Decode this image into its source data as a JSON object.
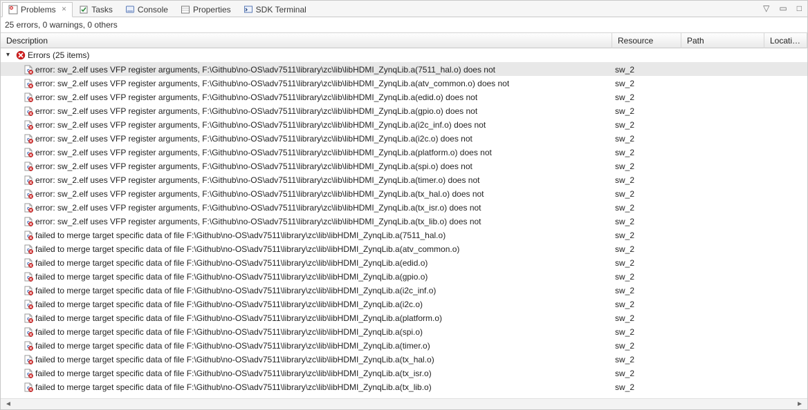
{
  "tabs": [
    {
      "label": "Problems",
      "active": true,
      "closable": true
    },
    {
      "label": "Tasks",
      "active": false
    },
    {
      "label": "Console",
      "active": false
    },
    {
      "label": "Properties",
      "active": false
    },
    {
      "label": "SDK Terminal",
      "active": false
    }
  ],
  "toolbar": {
    "menu_glyph": "▽",
    "minimize_glyph": "▭",
    "maximize_glyph": "□"
  },
  "summary": "25 errors, 0 warnings, 0 others",
  "columns": {
    "description": "Description",
    "resource": "Resource",
    "path": "Path",
    "location": "Location"
  },
  "group": {
    "label": "Errors (25 items)",
    "expanded": true
  },
  "items": [
    {
      "text": "error: sw_2.elf uses VFP register arguments, F:\\Github\\no-OS\\adv7511\\library\\zc\\lib\\libHDMI_ZynqLib.a(7511_hal.o) does not",
      "resource": "sw_2",
      "selected": true
    },
    {
      "text": "error: sw_2.elf uses VFP register arguments, F:\\Github\\no-OS\\adv7511\\library\\zc\\lib\\libHDMI_ZynqLib.a(atv_common.o) does not",
      "resource": "sw_2"
    },
    {
      "text": "error: sw_2.elf uses VFP register arguments, F:\\Github\\no-OS\\adv7511\\library\\zc\\lib\\libHDMI_ZynqLib.a(edid.o) does not",
      "resource": "sw_2"
    },
    {
      "text": "error: sw_2.elf uses VFP register arguments, F:\\Github\\no-OS\\adv7511\\library\\zc\\lib\\libHDMI_ZynqLib.a(gpio.o) does not",
      "resource": "sw_2"
    },
    {
      "text": "error: sw_2.elf uses VFP register arguments, F:\\Github\\no-OS\\adv7511\\library\\zc\\lib\\libHDMI_ZynqLib.a(i2c_inf.o) does not",
      "resource": "sw_2"
    },
    {
      "text": "error: sw_2.elf uses VFP register arguments, F:\\Github\\no-OS\\adv7511\\library\\zc\\lib\\libHDMI_ZynqLib.a(i2c.o) does not",
      "resource": "sw_2"
    },
    {
      "text": "error: sw_2.elf uses VFP register arguments, F:\\Github\\no-OS\\adv7511\\library\\zc\\lib\\libHDMI_ZynqLib.a(platform.o) does not",
      "resource": "sw_2"
    },
    {
      "text": "error: sw_2.elf uses VFP register arguments, F:\\Github\\no-OS\\adv7511\\library\\zc\\lib\\libHDMI_ZynqLib.a(spi.o) does not",
      "resource": "sw_2"
    },
    {
      "text": "error: sw_2.elf uses VFP register arguments, F:\\Github\\no-OS\\adv7511\\library\\zc\\lib\\libHDMI_ZynqLib.a(timer.o) does not",
      "resource": "sw_2"
    },
    {
      "text": "error: sw_2.elf uses VFP register arguments, F:\\Github\\no-OS\\adv7511\\library\\zc\\lib\\libHDMI_ZynqLib.a(tx_hal.o) does not",
      "resource": "sw_2"
    },
    {
      "text": "error: sw_2.elf uses VFP register arguments, F:\\Github\\no-OS\\adv7511\\library\\zc\\lib\\libHDMI_ZynqLib.a(tx_isr.o) does not",
      "resource": "sw_2"
    },
    {
      "text": "error: sw_2.elf uses VFP register arguments, F:\\Github\\no-OS\\adv7511\\library\\zc\\lib\\libHDMI_ZynqLib.a(tx_lib.o) does not",
      "resource": "sw_2"
    },
    {
      "text": "failed to merge target specific data of file F:\\Github\\no-OS\\adv7511\\library\\zc\\lib\\libHDMI_ZynqLib.a(7511_hal.o)",
      "resource": "sw_2"
    },
    {
      "text": "failed to merge target specific data of file F:\\Github\\no-OS\\adv7511\\library\\zc\\lib\\libHDMI_ZynqLib.a(atv_common.o)",
      "resource": "sw_2"
    },
    {
      "text": "failed to merge target specific data of file F:\\Github\\no-OS\\adv7511\\library\\zc\\lib\\libHDMI_ZynqLib.a(edid.o)",
      "resource": "sw_2"
    },
    {
      "text": "failed to merge target specific data of file F:\\Github\\no-OS\\adv7511\\library\\zc\\lib\\libHDMI_ZynqLib.a(gpio.o)",
      "resource": "sw_2"
    },
    {
      "text": "failed to merge target specific data of file F:\\Github\\no-OS\\adv7511\\library\\zc\\lib\\libHDMI_ZynqLib.a(i2c_inf.o)",
      "resource": "sw_2"
    },
    {
      "text": "failed to merge target specific data of file F:\\Github\\no-OS\\adv7511\\library\\zc\\lib\\libHDMI_ZynqLib.a(i2c.o)",
      "resource": "sw_2"
    },
    {
      "text": "failed to merge target specific data of file F:\\Github\\no-OS\\adv7511\\library\\zc\\lib\\libHDMI_ZynqLib.a(platform.o)",
      "resource": "sw_2"
    },
    {
      "text": "failed to merge target specific data of file F:\\Github\\no-OS\\adv7511\\library\\zc\\lib\\libHDMI_ZynqLib.a(spi.o)",
      "resource": "sw_2"
    },
    {
      "text": "failed to merge target specific data of file F:\\Github\\no-OS\\adv7511\\library\\zc\\lib\\libHDMI_ZynqLib.a(timer.o)",
      "resource": "sw_2"
    },
    {
      "text": "failed to merge target specific data of file F:\\Github\\no-OS\\adv7511\\library\\zc\\lib\\libHDMI_ZynqLib.a(tx_hal.o)",
      "resource": "sw_2"
    },
    {
      "text": "failed to merge target specific data of file F:\\Github\\no-OS\\adv7511\\library\\zc\\lib\\libHDMI_ZynqLib.a(tx_isr.o)",
      "resource": "sw_2"
    },
    {
      "text": "failed to merge target specific data of file F:\\Github\\no-OS\\adv7511\\library\\zc\\lib\\libHDMI_ZynqLib.a(tx_lib.o)",
      "resource": "sw_2"
    }
  ]
}
